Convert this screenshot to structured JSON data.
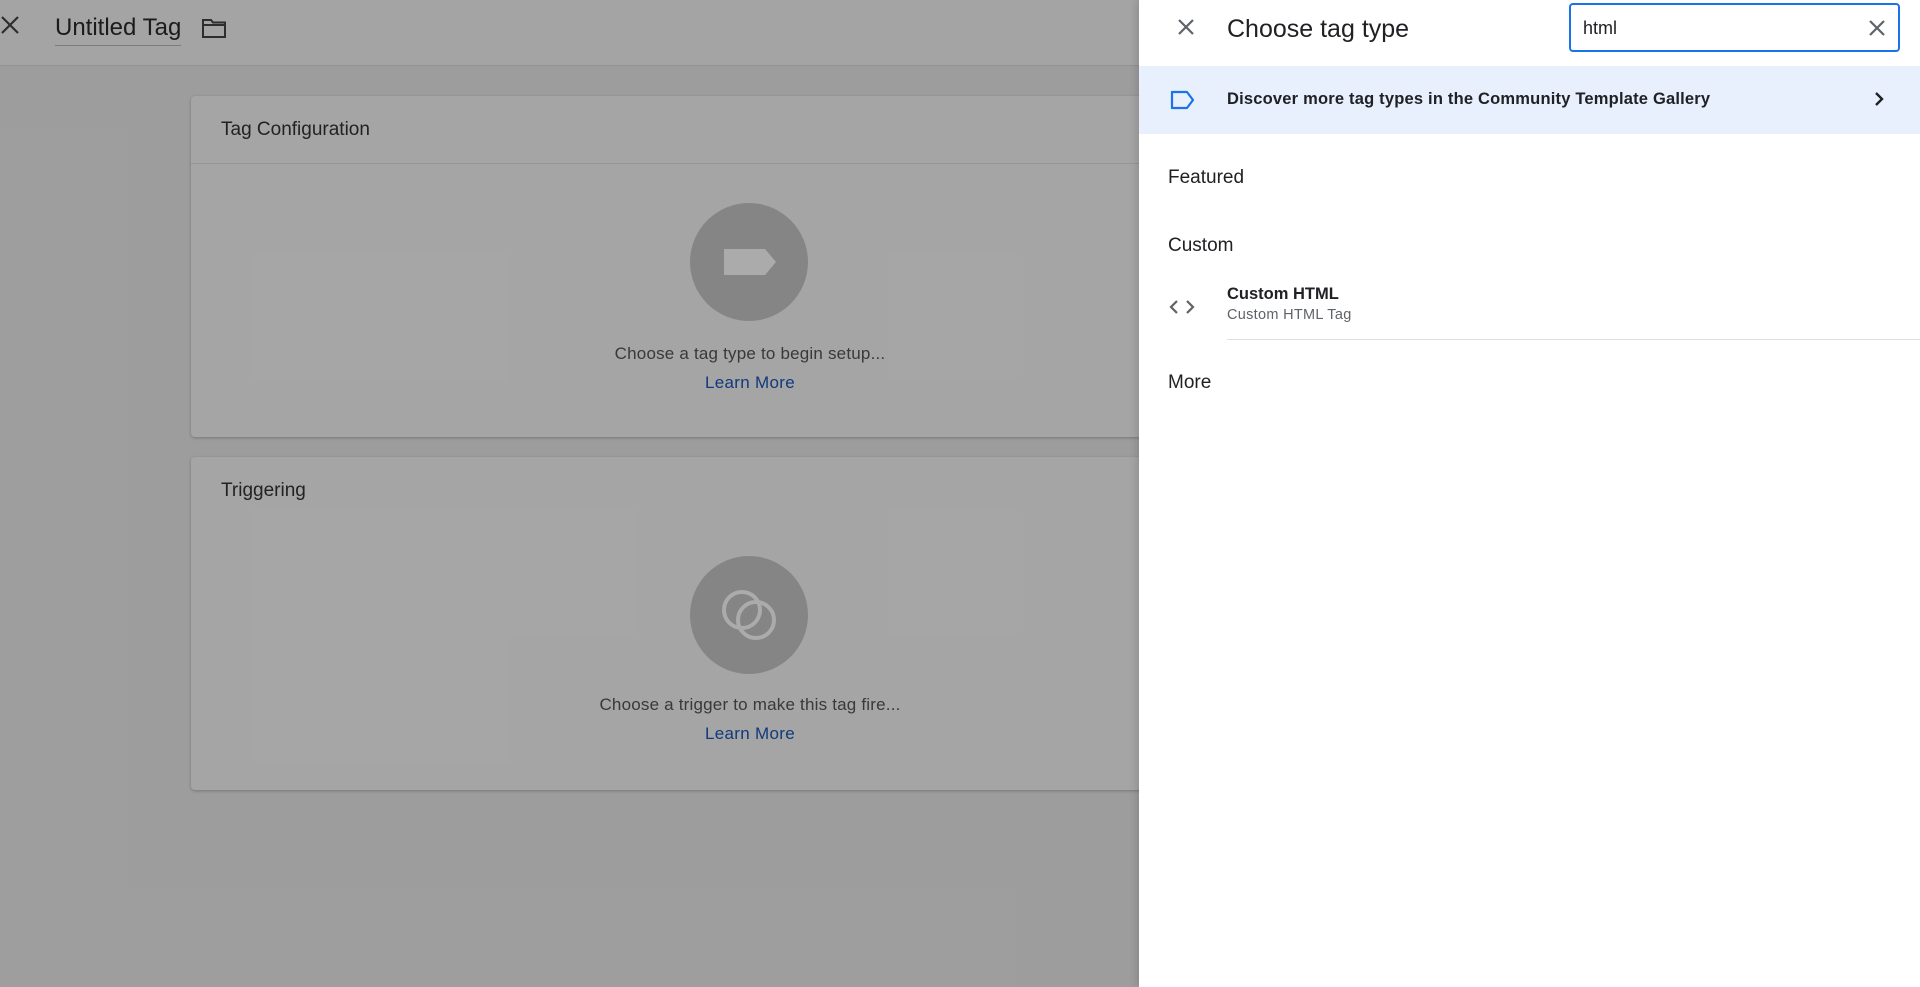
{
  "editor": {
    "title": "Untitled Tag",
    "close_icon": "close-icon",
    "folder_icon": "folder-icon",
    "tag_configuration": {
      "heading": "Tag Configuration",
      "placeholder_icon": "tag-icon",
      "message": "Choose a tag type to begin setup...",
      "link": "Learn More"
    },
    "triggering": {
      "heading": "Triggering",
      "placeholder_icon": "trigger-icon",
      "message": "Choose a trigger to make this tag fire...",
      "link": "Learn More"
    }
  },
  "panel": {
    "title": "Choose tag type",
    "close_icon": "close-icon",
    "search": {
      "value": "html",
      "clear_icon": "clear-icon"
    },
    "gallery_banner": {
      "icon": "tag-outline-icon",
      "text": "Discover more tag types in the Community Template Gallery",
      "chevron": "chevron-right-icon"
    },
    "sections": {
      "featured": "Featured",
      "custom": "Custom",
      "more": "More"
    },
    "custom_items": [
      {
        "icon": "code-icon",
        "title": "Custom HTML",
        "subtitle": "Custom HTML Tag"
      }
    ]
  },
  "colors": {
    "accent": "#1a73e8",
    "link": "#1a56b8",
    "banner_bg": "#e8f0fe"
  }
}
